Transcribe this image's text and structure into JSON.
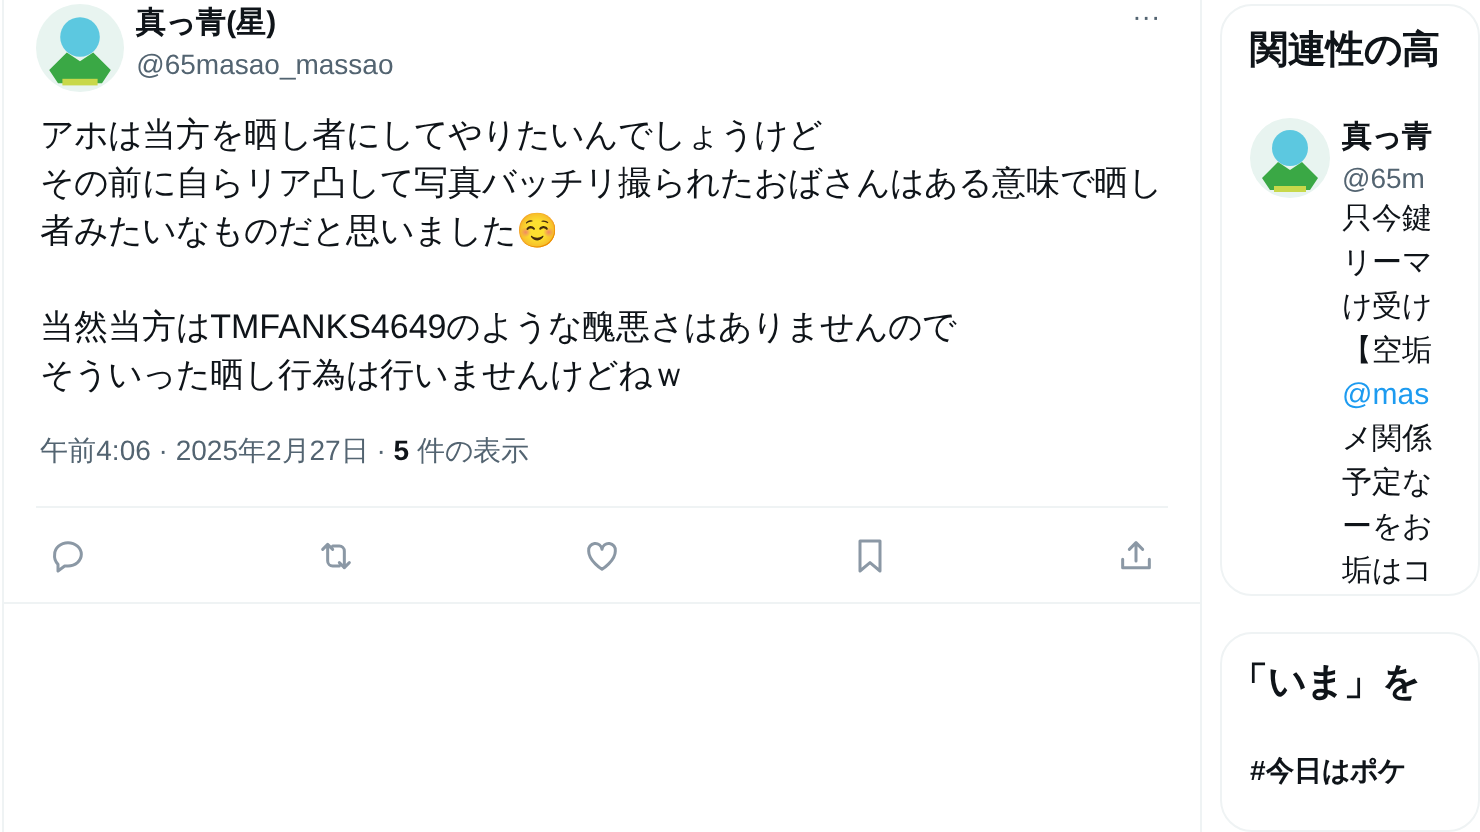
{
  "post": {
    "name": "真っ青(星)",
    "handle": "@65masao_massao",
    "more": "···",
    "paragraphs": [
      [
        "アホは当方を晒し者にしてやりたいんでしょうけど",
        "その前に自らリア凸して写真バッチリ撮られたおばさんはある意味で晒し者みたいなものだと思いました☺️"
      ],
      [
        "当然当方はTMFANKS4649のような醜悪さはありませんので",
        "そういった晒し行為は行いませんけどねｗ"
      ]
    ],
    "time": "午前4:06 · 2025年2月27日 · ",
    "views_count": "5",
    "views_label": " 件の表示",
    "actions": [
      {
        "kind": "reply"
      },
      {
        "kind": "repost"
      },
      {
        "kind": "like"
      },
      {
        "kind": "bookmark"
      },
      {
        "kind": "share"
      }
    ]
  },
  "related": {
    "title": "関連性の高",
    "name": "真っ青",
    "handle": "@65m",
    "lines": [
      {
        "kind": "text",
        "text": "只今鍵"
      },
      {
        "kind": "text",
        "text": "リーマ"
      },
      {
        "kind": "text",
        "text": "け受け"
      },
      {
        "kind": "text",
        "text": "【空垢"
      },
      {
        "kind": "link",
        "text": "@mas"
      },
      {
        "kind": "text",
        "text": "メ関係"
      },
      {
        "kind": "text",
        "text": "予定な"
      },
      {
        "kind": "text",
        "text": "ーをお"
      },
      {
        "kind": "text",
        "text": "垢はコ"
      }
    ]
  },
  "trends": {
    "title": "「いま」を",
    "items": [
      "#今日はポケ"
    ]
  }
}
